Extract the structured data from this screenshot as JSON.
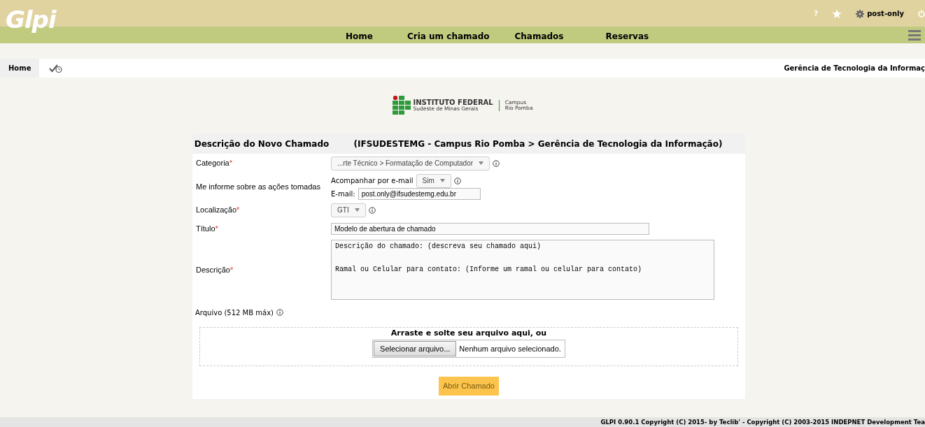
{
  "logo": {
    "text": "Glpi"
  },
  "top_links": [
    {
      "kind": "help",
      "label": "?"
    },
    {
      "kind": "star"
    },
    {
      "kind": "user",
      "label": "post-only"
    },
    {
      "kind": "power"
    }
  ],
  "menu": [
    {
      "label": "Home"
    },
    {
      "label": "Cria um chamado"
    },
    {
      "label": "Chamados"
    },
    {
      "label": "Reservas"
    }
  ],
  "breadcrumb": {
    "home": "Home",
    "entity": "Gerência de Tecnologia da Informaç"
  },
  "institution": {
    "name": "INSTITUTO FEDERAL",
    "region": "Sudeste de Minas Gerais",
    "campus": "Campus",
    "campus_name": "Rio Pomba"
  },
  "form": {
    "title": "Descrição do Novo Chamado",
    "entity_path": "(IFSUDESTEMG - Campus Rio Pomba > Gerência de Tecnologia da Informação)",
    "rows": [
      {
        "kind": "select",
        "label": "Categoria",
        "required_mark": "*",
        "value": "...rte Técnico > Formatação de Computador",
        "info": true
      },
      {
        "kind": "notify",
        "label": "Me informe sobre as ações tomadas",
        "follow_label": "Acompanhar por e-mail",
        "follow_value": "Sim",
        "email_label": "E-mail:",
        "email_value": "post.only@ifsudestemg.edu.br"
      },
      {
        "kind": "select",
        "label": "Localização",
        "required_mark": "*",
        "value": "GTI",
        "info": true
      },
      {
        "kind": "text",
        "label": "Título",
        "required_mark": "*",
        "value": "Modelo de abertura de chamado"
      },
      {
        "kind": "textarea",
        "label": "Descrição",
        "required_mark": "*",
        "value": "Descrição do chamado: (descreva seu chamado aqui)\n\n\nRamal ou Celular para contato: (Informe um ramal ou celular para contato)"
      }
    ],
    "file_label": "Arquivo (512 MB máx)",
    "drop_text": "Arraste e solte seu arquivo aqui, ou",
    "file_button": "Selecionar arquivo...",
    "file_status": "Nenhum arquivo selecionado.",
    "submit": "Abrir Chamado"
  },
  "footer": "GLPI 0.90.1 Copyright (C) 2015- by Teclib' - Copyright (C) 2003-2015 INDEPNET Development Tea"
}
